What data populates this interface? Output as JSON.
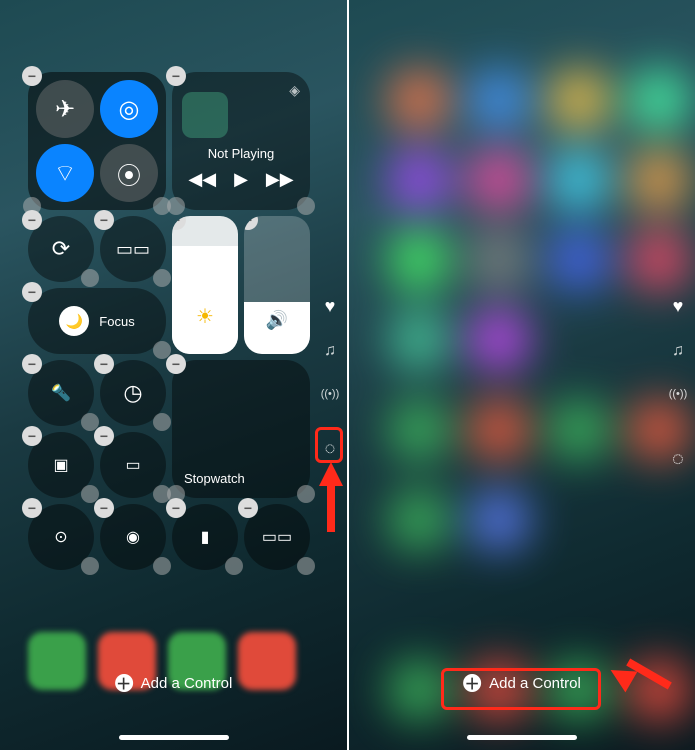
{
  "panels": {
    "left": {
      "connectivity": {
        "airplane": {
          "on": false,
          "icon": "✈"
        },
        "airdrop": {
          "on": true,
          "icon": "◎"
        },
        "wifi": {
          "on": true,
          "icon": "⌔"
        },
        "bluetooth_cellular": {
          "on": false,
          "icon": "⦿"
        }
      },
      "media": {
        "status": "Not Playing",
        "prev": "◀◀",
        "play": "▶",
        "next": "▶▶",
        "airplay": "◈"
      },
      "controls": {
        "rotation_lock": "⟳",
        "screen_mirroring": "▭▭",
        "focus_label": "Focus",
        "brightness_icon": "☀",
        "brightness_fill": 78,
        "volume_icon": "🔊",
        "volume_fill": 38,
        "flashlight": "🔦",
        "timer": "◷",
        "stopwatch_label": "Stopwatch",
        "scanner": "▣",
        "battery": "▭",
        "privacy": "⊙",
        "record": "◉",
        "remote": "▮",
        "mirror2": "▭▭"
      },
      "side_icons": {
        "heart": "♥",
        "music": "♫",
        "signal": "((•))",
        "highlighted": "◌"
      },
      "add_control": "Add a Control",
      "add_icon": "＋"
    },
    "right": {
      "add_control": "Add a Control",
      "add_icon": "＋",
      "side_icons": {
        "heart": "♥",
        "music": "♫",
        "signal": "((•))",
        "ring": "◌"
      }
    }
  },
  "annotations": {
    "highlight_color": "#ff2a1a"
  }
}
